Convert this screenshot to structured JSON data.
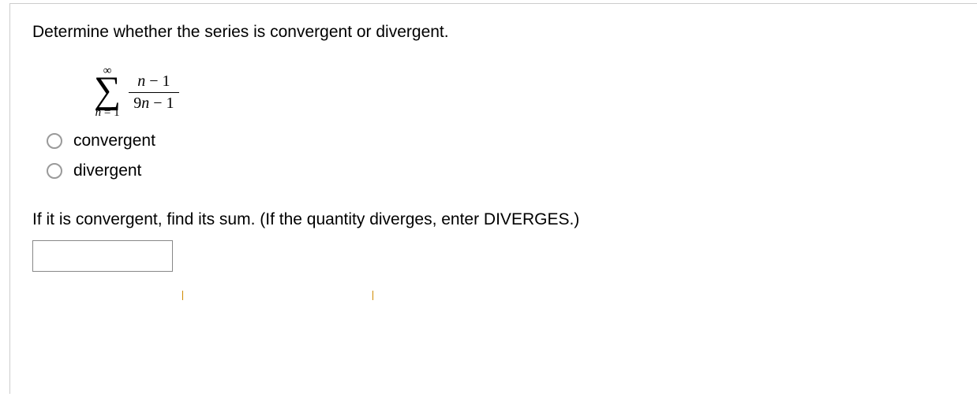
{
  "question": {
    "prompt": "Determine whether the series is convergent or divergent.",
    "series": {
      "upper": "∞",
      "lower_var": "n",
      "lower_eq": " = ",
      "lower_val": "1",
      "numerator_var": "n",
      "numerator_op": " − ",
      "numerator_const": "1",
      "denominator_coef": "9",
      "denominator_var": "n",
      "denominator_op": " − ",
      "denominator_const": "1"
    },
    "options": {
      "a": "convergent",
      "b": "divergent"
    },
    "part2_prompt": "If it is convergent, find its sum. (If the quantity diverges, enter DIVERGES.)",
    "answer_value": ""
  }
}
